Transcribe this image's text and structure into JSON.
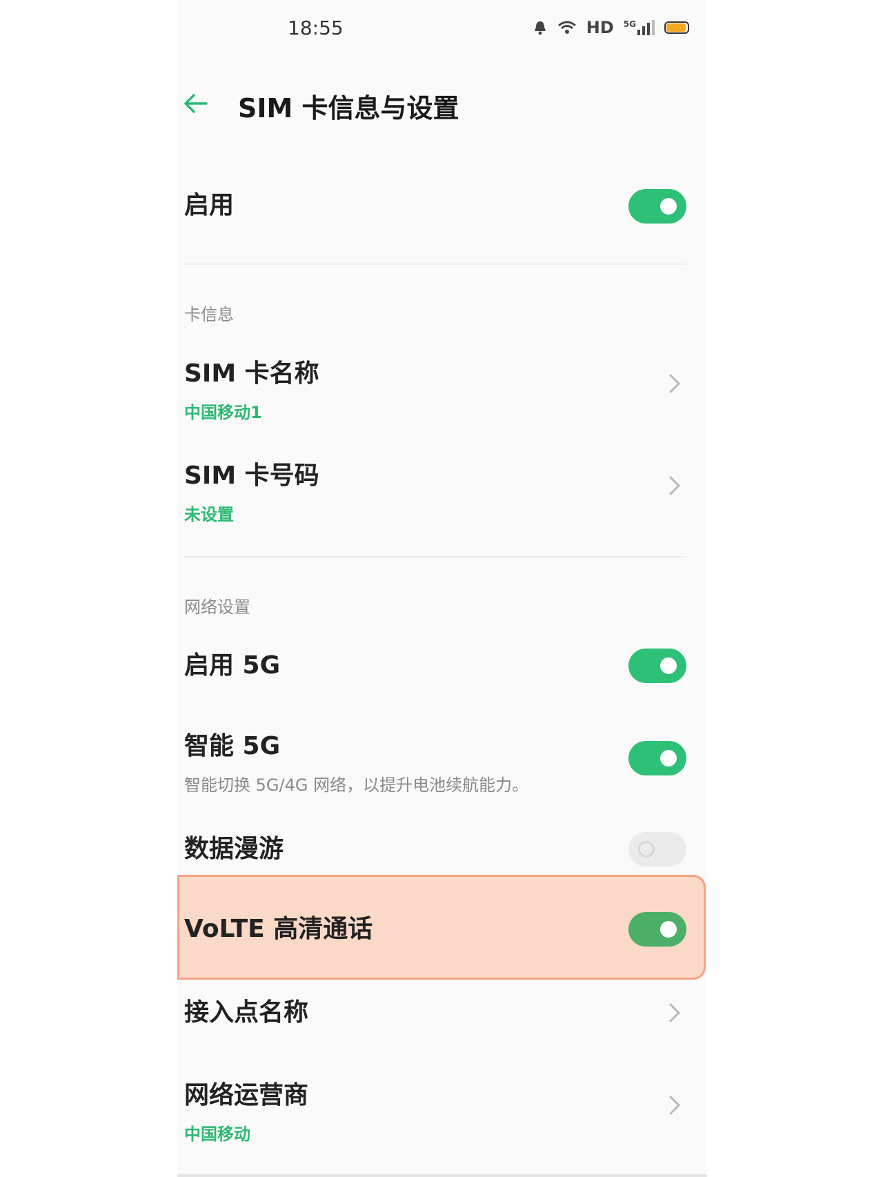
{
  "status_bar": {
    "time": "18:55",
    "hd_label": "HD",
    "network_label": "5G",
    "icons": [
      "alarm-icon",
      "wifi-icon",
      "signal-icon",
      "battery-icon"
    ],
    "battery_color": "#f5a623"
  },
  "header": {
    "title": "SIM 卡信息与设置",
    "back_icon": "arrow-left-icon",
    "accent": "#2eb872"
  },
  "enable": {
    "label": "启用",
    "on": true
  },
  "card_info": {
    "header": "卡信息",
    "items": [
      {
        "title": "SIM 卡名称",
        "value": "中国移动1"
      },
      {
        "title": "SIM 卡号码",
        "value": "未设置"
      }
    ]
  },
  "network": {
    "header": "网络设置",
    "enable_5g": {
      "label": "启用 5G",
      "on": true
    },
    "smart_5g": {
      "label": "智能 5G",
      "desc": "智能切换 5G/4G 网络，以提升电池续航能力。",
      "on": true
    },
    "data_roaming": {
      "label": "数据漫游",
      "on": false
    },
    "volte": {
      "label": "VoLTE 高清通话",
      "on": true,
      "highlight_color": "#fbd9c8"
    },
    "apn": {
      "label": "接入点名称"
    },
    "operator": {
      "label": "网络运营商",
      "value": "中国移动"
    }
  },
  "colors": {
    "toggle_on": "#2fc077",
    "secondary_text": "#8a8a8a"
  }
}
